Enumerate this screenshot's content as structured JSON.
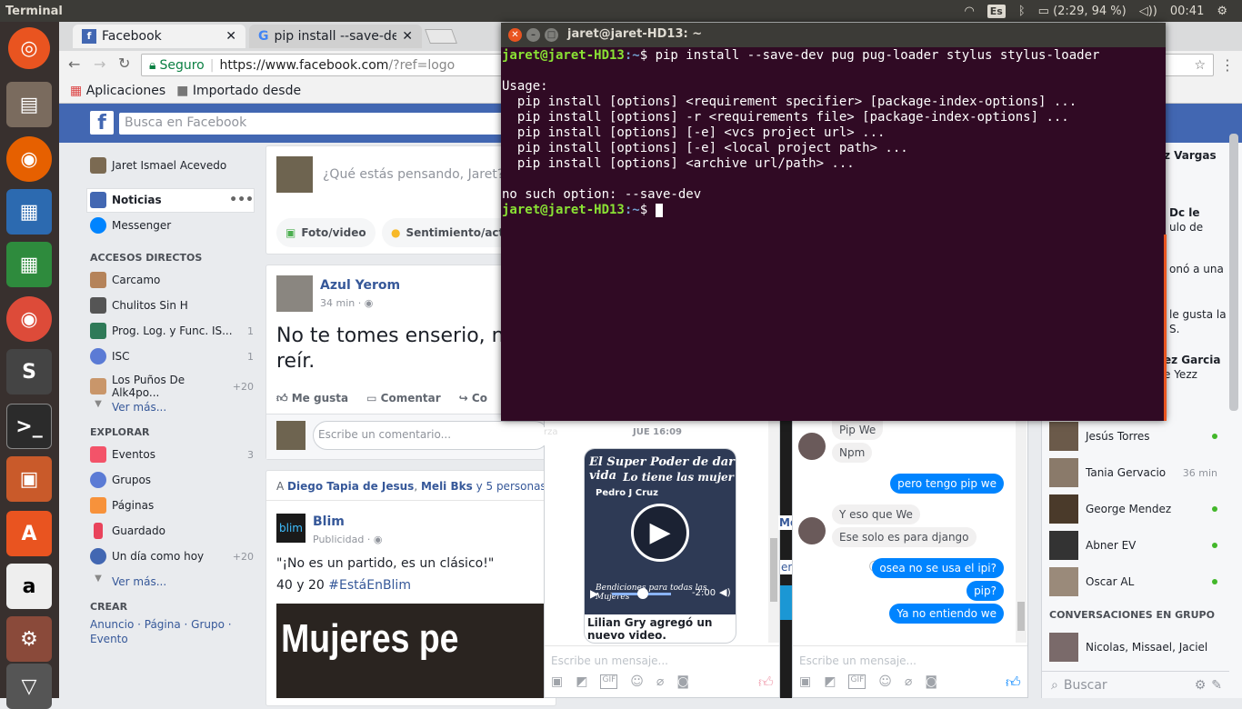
{
  "panel": {
    "title": "Terminal",
    "keyboard": "Es",
    "battery": "(2:29, 94 %)",
    "clock": "00:41"
  },
  "chrome": {
    "tabs": [
      {
        "label": "Facebook"
      },
      {
        "label": "pip install --save-de"
      }
    ],
    "secure": "Seguro",
    "url_base": "https://www.facebook.com",
    "url_rest": "/?ref=logo",
    "bookmarks": [
      "Aplicaciones",
      "Importado desde"
    ]
  },
  "fb": {
    "search_placeholder": "Busca en Facebook",
    "user": "Jaret Ismael Acevedo",
    "nav_main": [
      {
        "label": "Noticias"
      },
      {
        "label": "Messenger"
      }
    ],
    "accesos_title": "ACCESOS DIRECTOS",
    "accesos": [
      {
        "label": "Carcamo",
        "count": ""
      },
      {
        "label": "Chulitos Sin H",
        "count": ""
      },
      {
        "label": "Prog. Log. y Func. IS...",
        "count": "1"
      },
      {
        "label": "ISC",
        "count": "1"
      },
      {
        "label": "Los Puños De Alk4po...",
        "count": "+20"
      }
    ],
    "ver_mas": "Ver más...",
    "explorar_title": "EXPLORAR",
    "explorar": [
      {
        "label": "Eventos",
        "count": "3"
      },
      {
        "label": "Grupos",
        "count": ""
      },
      {
        "label": "Páginas",
        "count": ""
      },
      {
        "label": "Guardado",
        "count": ""
      },
      {
        "label": "Un día como hoy",
        "count": "+20"
      }
    ],
    "crear_title": "CREAR",
    "crear_links": "Anuncio · Página · Grupo ·",
    "crear_evento": "Evento",
    "composer_prompt": "¿Qué estás pensando, Jaret?",
    "composer_foto": "Foto/video",
    "composer_sent": "Sentimiento/activ",
    "post1": {
      "author": "Azul Yerom",
      "time": "34 min ·",
      "text_line1": "No te tomes enserio, na",
      "text_line2": "reír.",
      "like": "Me gusta",
      "comment": "Comentar",
      "share": "Co",
      "comment_placeholder": "Escribe un comentario..."
    },
    "post2": {
      "liked_prefix": "A",
      "liked_names": "Diego Tapia de Jesus",
      "liked_sep": ",",
      "liked_name2": "Meli Bks",
      "liked_rest": "y 5 personas más l",
      "author": "Blim",
      "sponsored": "Publicidad ·",
      "text1": "\"¡No es un partido, es un clásico!\"",
      "text2a": "40 y 20",
      "text2b": "#EstáEnBlim",
      "image_text": "Mujeres pe"
    }
  },
  "terminal": {
    "title": "jaret@jaret-HD13: ~",
    "prompt_user": "jaret@jaret-HD13",
    "prompt_path": ":~",
    "command": "$ pip install --save-dev pug pug-loader stylus stylus-loader",
    "usage": "Usage:",
    "lines": [
      "  pip install [options] <requirement specifier> [package-index-options] ...",
      "  pip install [options] -r <requirements file> [package-index-options] ...",
      "  pip install [options] [-e] <vcs project url> ...",
      "  pip install [options] [-e] <local project path> ...",
      "  pip install [options] <archive url/path> ..."
    ],
    "error": "no such option: --save-dev",
    "prompt_end": "$ "
  },
  "chat1": {
    "date": "JUE 16:09",
    "video_title1": "El Super Poder de dar vida",
    "video_title2": "Lo tiene las mujer",
    "video_author": "Pedro J Cruz",
    "video_footer": "Bendiciones para todas las Mujeres",
    "video_time": "-2:00",
    "caption": "Lilian Gry agregó un nuevo video.",
    "placeholder": "Escribe un mensaje..."
  },
  "chat2": {
    "messages": [
      {
        "from": "in",
        "text": "Pip We"
      },
      {
        "from": "in",
        "text": "Npm"
      },
      {
        "from": "out",
        "text": "pero  tengo pip we"
      },
      {
        "from": "in",
        "text": "Y eso que We"
      },
      {
        "from": "in",
        "text": "Ese solo es para django"
      },
      {
        "from": "out",
        "text": "osea no se usa el ipi?"
      },
      {
        "from": "out",
        "text": "pip?"
      },
      {
        "from": "out",
        "text": "Ya no entiendo we"
      }
    ],
    "placeholder": "Escribe un mensaje...",
    "left_frag1": "Mo",
    "left_frag2": "er"
  },
  "post_frag": "rza",
  "rside": {
    "peek": [
      {
        "text": "z Vargas"
      },
      {
        "text": "Dc le"
      },
      {
        "text": "ulo de"
      },
      {
        "text": "onó a una"
      },
      {
        "text": "le gusta la"
      },
      {
        "text": "S."
      },
      {
        "text": "ez Garcia"
      },
      {
        "text": "e Yezz"
      }
    ],
    "contacts": [
      {
        "name": "Jesús Torres",
        "time": "",
        "online": true
      },
      {
        "name": "Tania Gervacio",
        "time": "36 min",
        "online": false
      },
      {
        "name": "George Mendez",
        "time": "",
        "online": true
      },
      {
        "name": "Abner EV",
        "time": "",
        "online": true
      },
      {
        "name": "Oscar AL",
        "time": "",
        "online": true
      }
    ],
    "groups_title": "CONVERSACIONES EN GRUPO",
    "group": "Nicolas, Missael, Jaciel",
    "search": "Buscar"
  },
  "colors": {
    "fb_blue": "#4267b2",
    "terminal_bg": "#300a24",
    "prompt_green": "#8ae234",
    "prompt_blue": "#729fcf",
    "messenger_blue": "#0084ff"
  }
}
